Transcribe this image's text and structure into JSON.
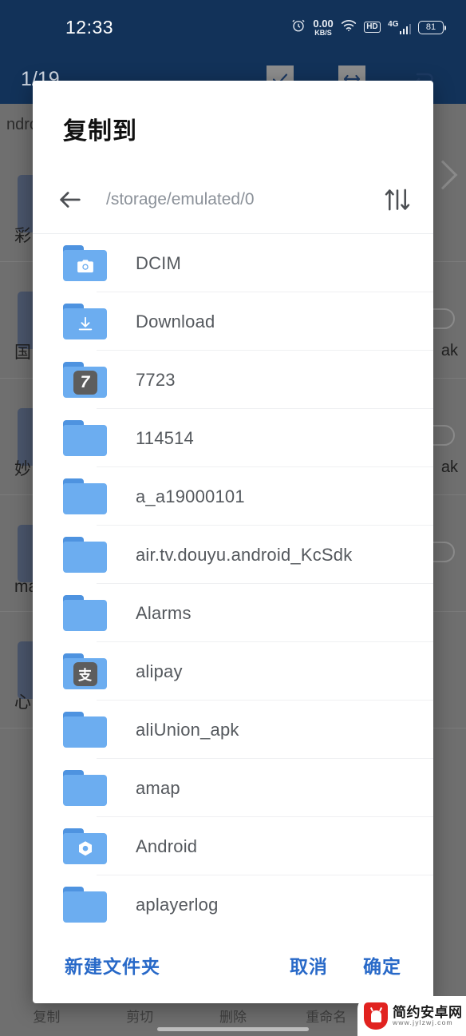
{
  "status_bar": {
    "time": "12:33",
    "alarm_icon": "alarm-clock-icon",
    "net_speed_value": "0.00",
    "net_speed_unit": "KB/S",
    "wifi_icon": "wifi-icon",
    "hd_label": "HD",
    "network_type": "4G",
    "battery_level": "81"
  },
  "background_app": {
    "selection_count": "1/19",
    "toolbar_icons": [
      "check-icon",
      "arrows-horizontal-icon",
      "undo-icon"
    ],
    "path_text": "ndroid",
    "rows": [
      {
        "label": "彩",
        "right": ""
      },
      {
        "label": "国",
        "right": "ak"
      },
      {
        "label": "妙",
        "right": "ak"
      },
      {
        "label": "ma",
        "right": ""
      },
      {
        "label": "心",
        "right": ""
      }
    ],
    "bottom_bar": [
      {
        "label": "复制"
      },
      {
        "label": "剪切"
      },
      {
        "label": "删除"
      },
      {
        "label": "重命名"
      }
    ]
  },
  "dialog": {
    "title": "复制到",
    "back_icon": "back-arrow-icon",
    "path": "/storage/emulated/0",
    "sort_icon": "sort-icon",
    "items": [
      {
        "name": "DCIM",
        "icon": "folder-camera-icon"
      },
      {
        "name": "Download",
        "icon": "folder-download-icon"
      },
      {
        "name": "7723",
        "icon": "folder-badge-icon",
        "badge": "7"
      },
      {
        "name": "114514",
        "icon": "folder-icon"
      },
      {
        "name": "a_a19000101",
        "icon": "folder-icon"
      },
      {
        "name": "air.tv.douyu.android_KcSdk",
        "icon": "folder-icon"
      },
      {
        "name": "Alarms",
        "icon": "folder-icon"
      },
      {
        "name": "alipay",
        "icon": "folder-badge-icon",
        "badge": "支"
      },
      {
        "name": "aliUnion_apk",
        "icon": "folder-icon"
      },
      {
        "name": "amap",
        "icon": "folder-icon"
      },
      {
        "name": "Android",
        "icon": "folder-gear-icon"
      },
      {
        "name": "aplayerlog",
        "icon": "folder-icon"
      }
    ],
    "actions": {
      "new_folder": "新建文件夹",
      "cancel": "取消",
      "confirm": "确定"
    }
  },
  "watermark": {
    "title": "简约安卓网",
    "url": "www.jylzwj.com",
    "logo_icon": "android-shield-logo-icon"
  },
  "colors": {
    "status_bar": "#123259",
    "accent_blue": "#2869c8",
    "folder_blue": "#6cadf0",
    "scrim": "#6f6f6f",
    "watermark_red": "#e1221f"
  }
}
